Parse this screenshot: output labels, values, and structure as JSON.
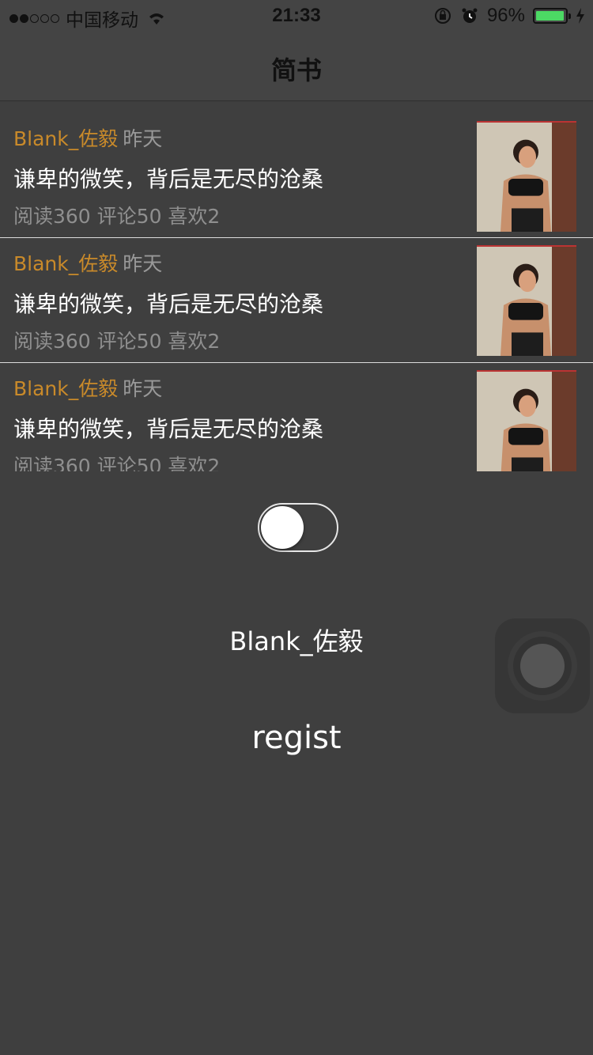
{
  "status_bar": {
    "signal_dots": [
      true,
      true,
      false,
      false,
      false
    ],
    "carrier": "中国移动",
    "time": "21:33",
    "battery": "96%",
    "battery_level": 0.96,
    "battery_color": "#4cd964"
  },
  "nav": {
    "title": "简书"
  },
  "articles": [
    {
      "author": "Blank_佐毅",
      "time": "昨天",
      "title": "谦卑的微笑，背后是无尽的沧桑",
      "stats": "阅读360 评论50 喜欢2"
    },
    {
      "author": "Blank_佐毅",
      "time": "昨天",
      "title": "谦卑的微笑，背后是无尽的沧桑",
      "stats": "阅读360 评论50 喜欢2"
    },
    {
      "author": "Blank_佐毅",
      "time": "昨天",
      "title": "谦卑的微笑，背后是无尽的沧桑",
      "stats": "阅读360 评论50 喜欢2"
    }
  ],
  "toggle": {
    "on": false
  },
  "user_label": "Blank_佐毅",
  "regist_label": "regist",
  "colors": {
    "author": "#c98a2a",
    "background": "#3f3f3f"
  }
}
